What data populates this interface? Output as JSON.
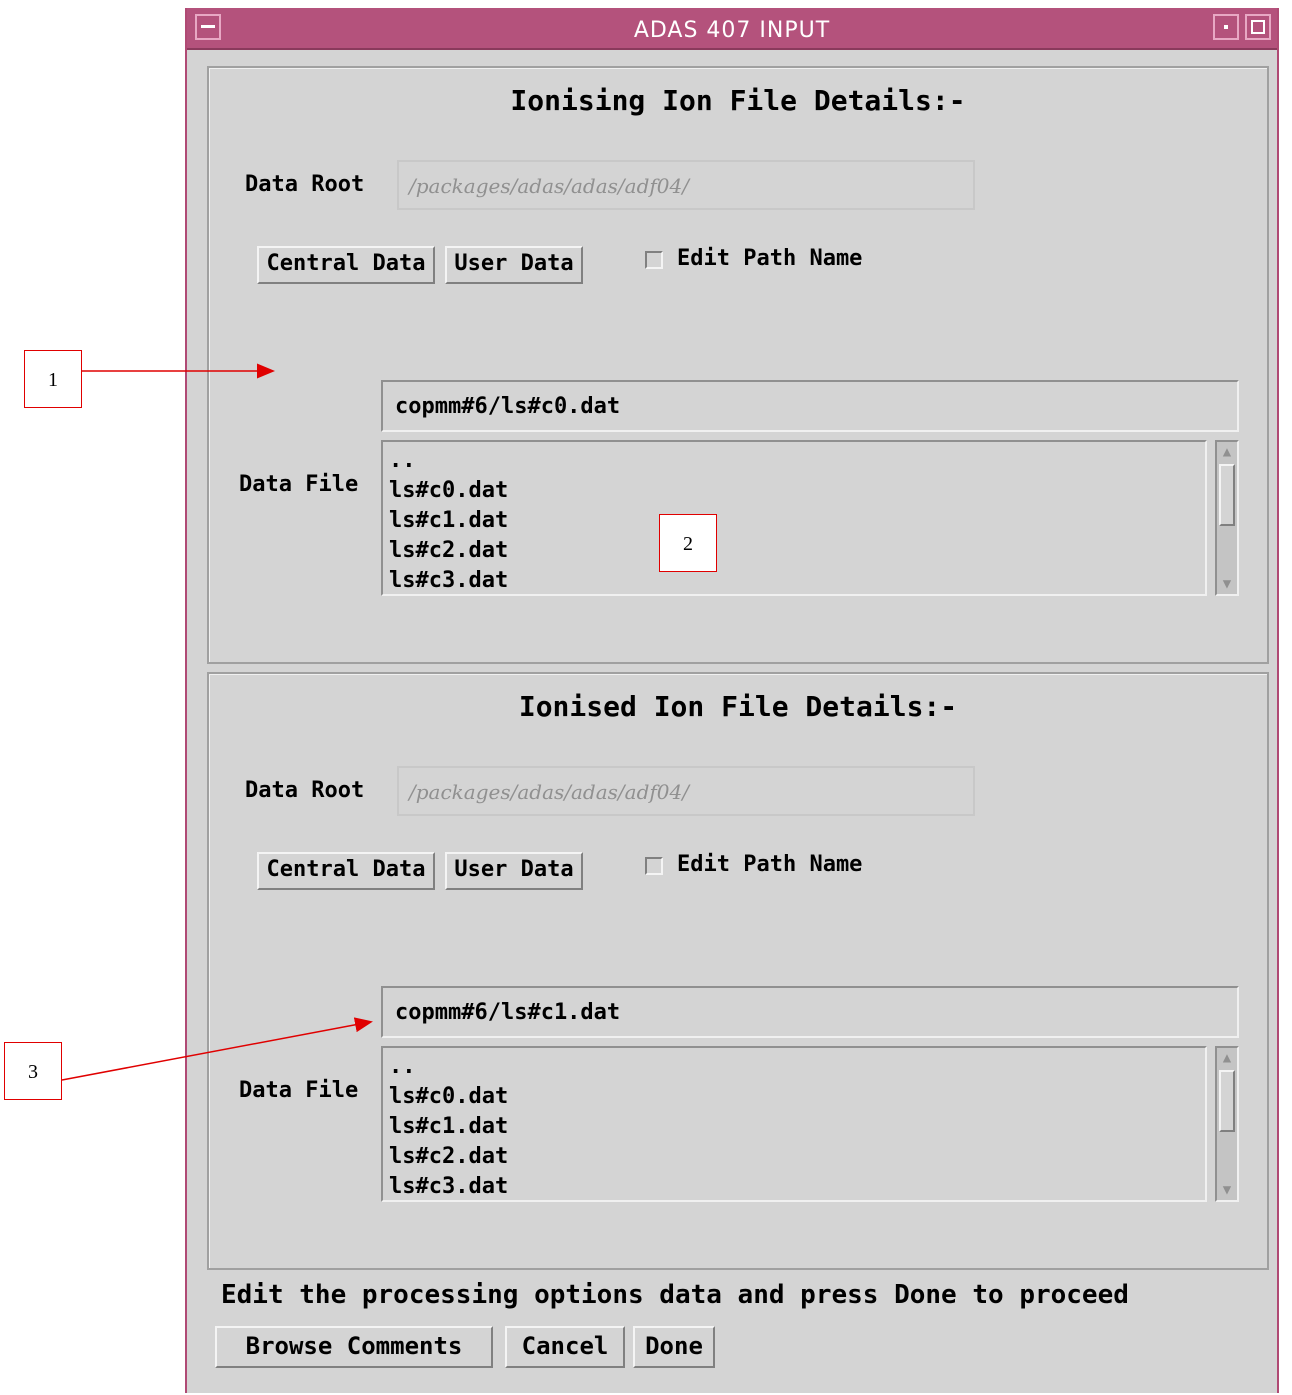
{
  "window": {
    "title": "ADAS 407 INPUT"
  },
  "sections": [
    {
      "heading": "Ionising Ion File Details:-",
      "data_root_label": "Data Root",
      "data_root_value": "/packages/adas/adas/adf04/",
      "central_button": "Central Data",
      "user_button": "User Data",
      "edit_path_label": "Edit Path Name",
      "data_file_label": "Data File",
      "selected_file": "copmm#6/ls#c0.dat",
      "files": [
        "..",
        "ls#c0.dat",
        "ls#c1.dat",
        "ls#c2.dat",
        "ls#c3.dat"
      ]
    },
    {
      "heading": "Ionised Ion File Details:-",
      "data_root_label": "Data Root",
      "data_root_value": "/packages/adas/adas/adf04/",
      "central_button": "Central Data",
      "user_button": "User Data",
      "edit_path_label": "Edit Path Name",
      "data_file_label": "Data File",
      "selected_file": "copmm#6/ls#c1.dat",
      "files": [
        "..",
        "ls#c0.dat",
        "ls#c1.dat",
        "ls#c2.dat",
        "ls#c3.dat"
      ]
    }
  ],
  "status_message": "Edit the processing options data and press Done to proceed",
  "buttons": {
    "browse": "Browse Comments",
    "cancel": "Cancel",
    "done": "Done"
  },
  "callouts": [
    "1",
    "2",
    "3"
  ],
  "colors": {
    "titlebar": "#b4527c",
    "window_bg": "#d4d4d4",
    "callout_border": "#e00000"
  }
}
